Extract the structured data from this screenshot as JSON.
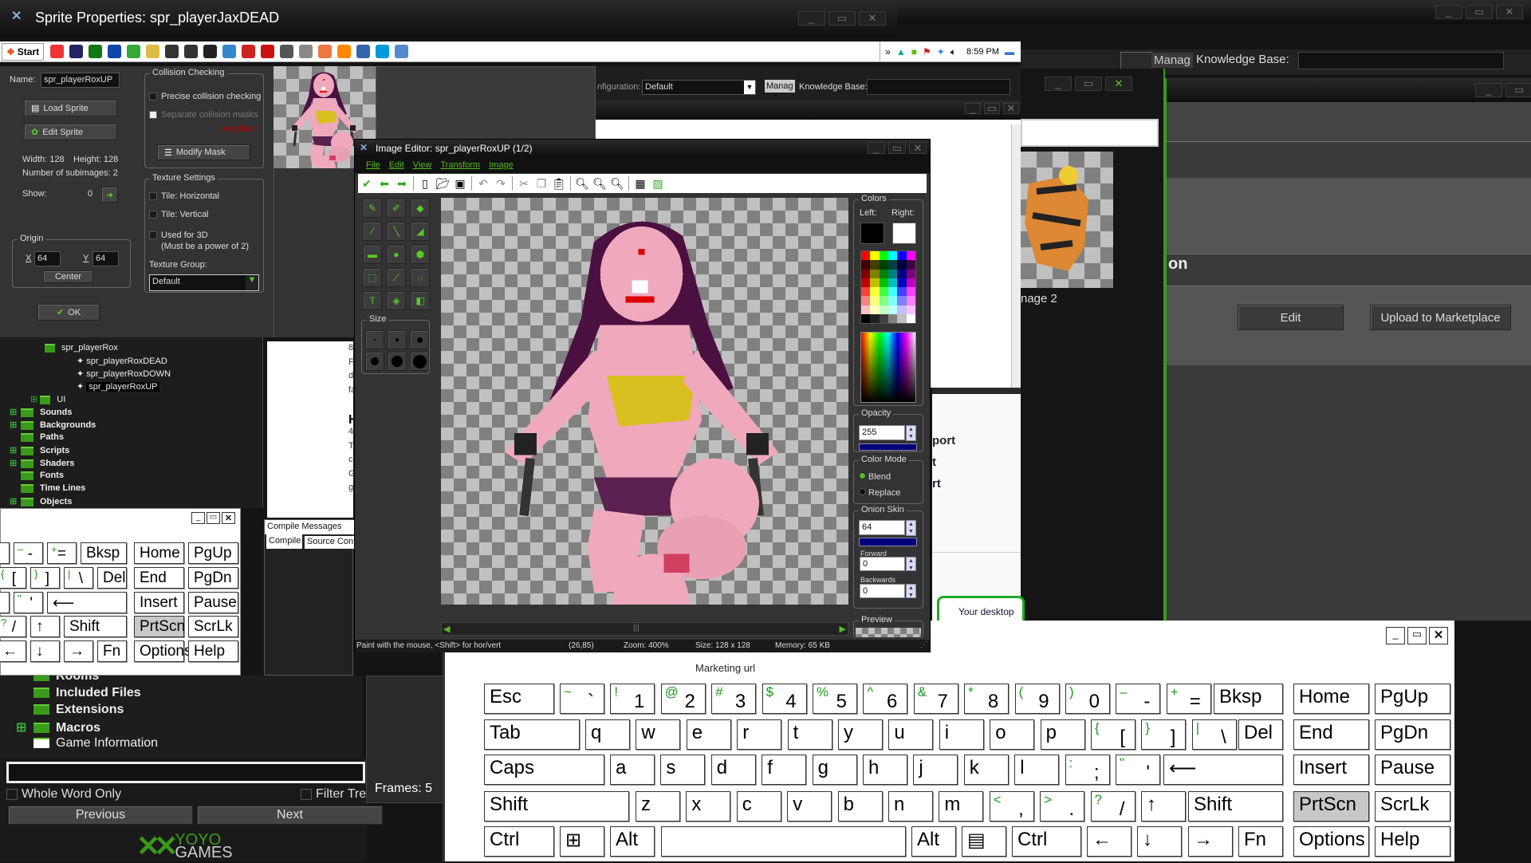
{
  "sprite_props": {
    "title": "Sprite Properties: spr_playerJaxDEAD",
    "name_label": "Name:",
    "name_value": "spr_playerRoxUP",
    "load_sprite": "Load Sprite",
    "edit_sprite": "Edit Sprite",
    "width": "Width: 128",
    "height": "Height: 128",
    "subimages": "Number of subimages: 2",
    "show_label": "Show:",
    "show_value": "0",
    "origin": {
      "label": "Origin",
      "x_label": "X",
      "x": "64",
      "y_label": "Y",
      "y": "64",
      "center": "Center"
    },
    "ok": "OK",
    "collision": {
      "label": "Collision Checking",
      "precise": "Precise collision checking",
      "separate": "Separate collision masks",
      "modified": "Modified",
      "modify_mask": "Modify Mask"
    },
    "texture": {
      "label": "Texture Settings",
      "tile_h": "Tile: Horizontal",
      "tile_v": "Tile: Vertical",
      "used3d": "Used for 3D",
      "power2": "(Must be a power of 2)",
      "group_label": "Texture Group:",
      "group_value": "Default"
    }
  },
  "taskbar": {
    "start": "Start",
    "clock": "8:59 PM",
    "icons": [
      "chrome-icon",
      "gamemaker-icon",
      "gamemaker-studio-icon",
      "photoshop-icon",
      "evernote-icon",
      "explorer-icon",
      "7zip-icon",
      "unity-icon",
      "monitor-icon",
      "globe-icon",
      "winrar-icon",
      "filezilla-icon",
      "binoculars-icon",
      "usb-icon",
      "grid-icon",
      "vlc-icon",
      "network-icon",
      "skype-icon",
      "keyboard-icon"
    ]
  },
  "ide_bar": {
    "configuration_label": "nfiguration:",
    "configuration_value": "Default",
    "manage": "Manag",
    "knowledge_base": "Knowledge Base:"
  },
  "image_editor": {
    "title": "Image Editor: spr_playerRoxUP (1/2)",
    "menu": [
      "File",
      "Edit",
      "View",
      "Transform",
      "Image"
    ],
    "size_label": "Size",
    "colors": {
      "label": "Colors",
      "left": "Left:",
      "right": "Right:",
      "left_color": "#000000",
      "right_color": "#ffffff",
      "palette": [
        "#ff0000",
        "#ffff00",
        "#00ff00",
        "#00ffff",
        "#0000ff",
        "#ff00ff",
        "#400000",
        "#404000",
        "#004000",
        "#004040",
        "#000040",
        "#400040",
        "#800000",
        "#808000",
        "#008000",
        "#008080",
        "#000080",
        "#800080",
        "#c00000",
        "#c0c000",
        "#00c000",
        "#00c0c0",
        "#0000c0",
        "#c000c0",
        "#ff4040",
        "#ffff40",
        "#40ff40",
        "#40ffff",
        "#4040ff",
        "#ff40ff",
        "#ff8080",
        "#ffff80",
        "#80ff80",
        "#80ffff",
        "#8080ff",
        "#ff80ff",
        "#ffc0c0",
        "#ffffc0",
        "#c0ffc0",
        "#c0ffff",
        "#c0c0ff",
        "#ffc0ff",
        "#000000",
        "#202020",
        "#404040",
        "#808080",
        "#c0c0c0",
        "#ffffff"
      ]
    },
    "opacity": {
      "label": "Opacity",
      "value": "255"
    },
    "color_mode": {
      "label": "Color Mode",
      "blend": "Blend",
      "replace": "Replace",
      "selected": "Blend"
    },
    "onion": {
      "label": "Onion Skin",
      "value": "64",
      "forward_label": "Forward",
      "forward": "0",
      "backwards_label": "Backwards",
      "backwards": "0"
    },
    "preview_label": "Preview",
    "status": {
      "hint": "Paint with the mouse, <Shift> for hor/vert",
      "coords": "(26,85)",
      "zoom": "Zoom: 400%",
      "size": "Size: 128 x 128",
      "memory": "Memory: 65 KB"
    }
  },
  "resource_tree": {
    "items": [
      "spr_playerRox",
      "spr_playerRoxDEAD",
      "spr_playerRoxDOWN",
      "spr_playerRoxUP",
      "UI",
      "Sounds",
      "Backgrounds",
      "Paths",
      "Scripts",
      "Shaders",
      "Fonts",
      "Time Lines",
      "Objects"
    ],
    "lower_items": [
      "Rooms",
      "Included Files",
      "Extensions",
      "Macros",
      "Game Information"
    ],
    "whole_word": "Whole Word Only",
    "filter": "Filter Tre",
    "previous": "Previous",
    "next": "Next",
    "logo": "YOYO GAMES"
  },
  "news_panel": {
    "lines": [
      "8",
      "F",
      "d",
      "fa",
      "",
      "H",
      "4",
      "T",
      "c",
      "G",
      "g"
    ]
  },
  "compile": {
    "title": "Compile Messages",
    "tabs": [
      "Compile",
      "Source Cont"
    ]
  },
  "frames": "Frames: 5",
  "side_text": [
    "port",
    "t",
    "rt"
  ],
  "desktop_notice": "Your desktop",
  "marketplace": {
    "subimage_label": "nage 2",
    "heading": "on",
    "edit": "Edit",
    "upload": "Upload to Marketplace"
  },
  "marketing_url": "Marketing url",
  "small_keyboard": {
    "rows": [
      [
        {
          "m": "0"
        },
        {
          "s": "–",
          "m": "-"
        },
        {
          "s": "+",
          "m": "="
        },
        {
          "m": "Bksp"
        },
        {
          "m": "Home"
        },
        {
          "m": "PgUp"
        }
      ],
      [
        {
          "s": "{",
          "m": "["
        },
        {
          "s": "}",
          "m": "]"
        },
        {
          "s": "|",
          "m": "\\"
        },
        {
          "m": "Del"
        },
        {
          "m": "End"
        },
        {
          "m": "PgDn"
        }
      ],
      [
        {
          "m": ""
        },
        {
          "s": "\"",
          "m": "'"
        },
        {
          "m": "⟵"
        },
        {
          "m": "Insert"
        },
        {
          "m": "Pause"
        }
      ],
      [
        {
          "s": "?",
          "m": "/"
        },
        {
          "m": "↑"
        },
        {
          "m": "Shift"
        },
        {
          "m": "PrtScn",
          "active": true
        },
        {
          "m": "ScrLk"
        }
      ],
      [
        {
          "m": "←"
        },
        {
          "m": "↓"
        },
        {
          "m": "→"
        },
        {
          "m": "Fn"
        },
        {
          "m": "Options"
        },
        {
          "m": "Help"
        }
      ]
    ]
  },
  "keyboard": {
    "rows": [
      [
        {
          "m": "Esc"
        },
        {
          "s": "~",
          "m": "`"
        },
        {
          "s": "!",
          "m": "1"
        },
        {
          "s": "@",
          "m": "2"
        },
        {
          "s": "#",
          "m": "3"
        },
        {
          "s": "$",
          "m": "4"
        },
        {
          "s": "%",
          "m": "5"
        },
        {
          "s": "^",
          "m": "6"
        },
        {
          "s": "&",
          "m": "7"
        },
        {
          "s": "*",
          "m": "8"
        },
        {
          "s": "(",
          "m": "9"
        },
        {
          "s": ")",
          "m": "0"
        },
        {
          "s": "–",
          "m": "-"
        },
        {
          "s": "+",
          "m": "="
        },
        {
          "m": "Bksp"
        },
        {
          "m": "Home"
        },
        {
          "m": "PgUp"
        }
      ],
      [
        {
          "m": "Tab"
        },
        {
          "m": "q"
        },
        {
          "m": "w"
        },
        {
          "m": "e"
        },
        {
          "m": "r"
        },
        {
          "m": "t"
        },
        {
          "m": "y"
        },
        {
          "m": "u"
        },
        {
          "m": "i"
        },
        {
          "m": "o"
        },
        {
          "m": "p"
        },
        {
          "s": "{",
          "m": "["
        },
        {
          "s": "}",
          "m": "]"
        },
        {
          "s": "|",
          "m": "\\"
        },
        {
          "m": "Del"
        },
        {
          "m": "End"
        },
        {
          "m": "PgDn"
        }
      ],
      [
        {
          "m": "Caps"
        },
        {
          "m": "a"
        },
        {
          "m": "s"
        },
        {
          "m": "d"
        },
        {
          "m": "f"
        },
        {
          "m": "g"
        },
        {
          "m": "h"
        },
        {
          "m": "j"
        },
        {
          "m": "k"
        },
        {
          "m": "l"
        },
        {
          "s": ":",
          "m": ";"
        },
        {
          "s": "\"",
          "m": "'"
        },
        {
          "m": "⟵"
        },
        {
          "m": "Insert"
        },
        {
          "m": "Pause"
        }
      ],
      [
        {
          "m": "Shift"
        },
        {
          "m": "z"
        },
        {
          "m": "x"
        },
        {
          "m": "c"
        },
        {
          "m": "v"
        },
        {
          "m": "b"
        },
        {
          "m": "n"
        },
        {
          "m": "m"
        },
        {
          "s": "<",
          "m": ","
        },
        {
          "s": ">",
          "m": "."
        },
        {
          "s": "?",
          "m": "/"
        },
        {
          "m": "↑"
        },
        {
          "m": "Shift"
        },
        {
          "m": "PrtScn",
          "active": true
        },
        {
          "m": "ScrLk"
        }
      ],
      [
        {
          "m": "Ctrl"
        },
        {
          "m": "⊞"
        },
        {
          "m": "Alt"
        },
        {
          "m": ""
        },
        {
          "m": "Alt"
        },
        {
          "m": "▤"
        },
        {
          "m": "Ctrl"
        },
        {
          "m": "←"
        },
        {
          "m": "↓"
        },
        {
          "m": "→"
        },
        {
          "m": "Fn"
        },
        {
          "m": "Options"
        },
        {
          "m": "Help"
        }
      ]
    ]
  },
  "accent": "#3a9a1a"
}
